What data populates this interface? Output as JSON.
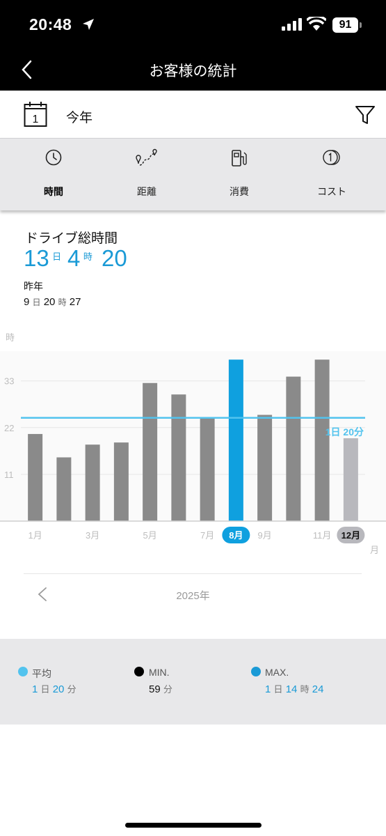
{
  "status_bar": {
    "time": "20:48",
    "battery": "91"
  },
  "nav": {
    "title": "お客様の統計"
  },
  "period": {
    "calendar_day": "1",
    "label": "今年"
  },
  "tabs": [
    {
      "label": "時間",
      "icon": "clock-icon",
      "active": true
    },
    {
      "label": "距離",
      "icon": "route-icon",
      "active": false
    },
    {
      "label": "消費",
      "icon": "fuel-pump-icon",
      "active": false
    },
    {
      "label": "コスト",
      "icon": "coin-icon",
      "active": false
    }
  ],
  "summary": {
    "title": "ドライブ総時間",
    "days": "13",
    "days_unit": "日",
    "hours": "4",
    "hours_unit": "時",
    "minutes": "20",
    "previous_label": "昨年",
    "prev_days": "9",
    "prev_days_unit": "日",
    "prev_hours": "20",
    "prev_hours_unit": "時",
    "prev_minutes": "27"
  },
  "chart_data": {
    "type": "bar",
    "y_unit": "時",
    "x_unit": "月",
    "y_ticks": [
      11,
      22,
      33
    ],
    "ylim": [
      0,
      40
    ],
    "categories": [
      "1月",
      "2月",
      "3月",
      "4月",
      "5月",
      "6月",
      "7月",
      "8月",
      "9月",
      "10月",
      "11月",
      "12月"
    ],
    "values": [
      20.5,
      15,
      18,
      18.5,
      32.5,
      29.8,
      24.5,
      38,
      25,
      34,
      38,
      19.5
    ],
    "visible_tick_labels": [
      "1月",
      "3月",
      "5月",
      "7月",
      "8月",
      "9月",
      "11月",
      "12月"
    ],
    "selected": "8月",
    "current": "12月",
    "average_value": 24.3,
    "average_label": "1日 20分",
    "colors": {
      "bar": "#8a8a8a",
      "selected": "#0fa0df",
      "current": "#b8b8bd",
      "average": "#52c3ee",
      "grid": "#e6e6e6"
    }
  },
  "year_nav": {
    "label": "2025年"
  },
  "stats": {
    "avg_label": "平均",
    "avg_days": "1",
    "avg_days_unit": "日",
    "avg_minutes": "20",
    "avg_minutes_unit": "分",
    "min_label": "MIN.",
    "min_minutes": "59",
    "min_minutes_unit": "分",
    "max_label": "MAX.",
    "max_days": "1",
    "max_days_unit": "日",
    "max_hours": "14",
    "max_hours_unit": "時",
    "max_minutes": "24",
    "colors": {
      "avg": "#52c3ee",
      "min": "#000000",
      "max": "#1a9ad6"
    }
  }
}
